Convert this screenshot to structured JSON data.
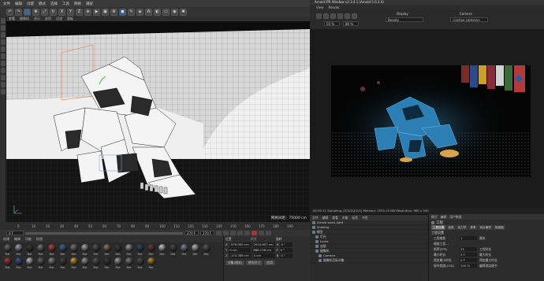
{
  "c4d": {
    "menubar": [
      "文件",
      "编辑",
      "创建",
      "模式",
      "选择",
      "工具",
      "网格",
      "捕捉"
    ],
    "toolbar_x_label": "X",
    "toolbar_y_label": "Y",
    "toolbar_z_label": "Z",
    "viewport_header": [
      "查看",
      "摄像机",
      "显示",
      "选项",
      "过滤",
      "面板"
    ],
    "grid_spacing": "网格间距：75000 cm",
    "timeline_ticks": [
      "0",
      "10",
      "20",
      "30",
      "40",
      "50",
      "60",
      "70",
      "80",
      "90",
      "100",
      "110",
      "120",
      "130",
      "140",
      "150",
      "160",
      "170",
      "180",
      "190"
    ],
    "current_frame": "0 F",
    "end_frame_1": "270 F",
    "end_frame_2": "270 F",
    "material_header": [
      "创建",
      "编辑",
      "功能",
      "纹理"
    ],
    "materials": [
      "Mat",
      "Mat",
      "Mat",
      "Mat",
      "Mat",
      "Mat",
      "Mat",
      "Mat",
      "Mat",
      "Mat",
      "Mat",
      "Mat",
      "Mat",
      "Mat",
      "Mat",
      "Mat",
      "Mat",
      "Mat",
      "Mat",
      "Mat",
      "Mat",
      "Mat",
      "Mat",
      "Mat",
      "Mat",
      "Mat",
      "Mat",
      "Mat",
      "Mat",
      "Mat",
      "Mat",
      "Mat",
      "Mat"
    ],
    "coords": {
      "headers": [
        "位置",
        "尺寸",
        "旋转"
      ],
      "rows": [
        {
          "axis": "X",
          "pos": "-576.983 cm",
          "size": "2024.657 cm",
          "rot_label": "H",
          "rot": "0 °"
        },
        {
          "axis": "Y",
          "pos": "0 cm",
          "size": "868.136 cm",
          "rot_label": "P",
          "rot": "0 °"
        },
        {
          "axis": "Z",
          "pos": "-174.389 cm",
          "size": "0 cm",
          "rot_label": "B",
          "rot": "0 °"
        }
      ],
      "mode_object": "对象(相对)",
      "mode_size": "绝对尺寸",
      "apply_button": "应用"
    }
  },
  "arnold": {
    "title": "Arnold IPR Window v2.3.4.1 (Arnold 5.0.2.4)",
    "menu": [
      "View",
      "Render"
    ],
    "toolbar_display_label": "Display",
    "toolbar_camera_label": "Camera",
    "zoom": "50 %",
    "size_pct": "80 %",
    "display_value": "Beauty",
    "camera_value": "<active camera>",
    "status": "00:00:11  Sampling: [3/2/2/2/2/2]  Memory: 1555.19 MB  Resolution: 960 x 540"
  },
  "object_manager": {
    "header": [
      "文件",
      "编辑",
      "查看",
      "对象",
      "标签",
      "书签"
    ],
    "rows": [
      "Arnold quad_light",
      "Shading",
      "模型",
      "灯光",
      "Luma",
      "连接",
      "摄像机",
      "Camera",
      "摄像机目标对象"
    ]
  },
  "attribute_manager": {
    "header": [
      "模式",
      "编辑",
      "用户数据"
    ],
    "project_label": "工程",
    "tabs": [
      "工程设置",
      "信息",
      "动力学",
      "参考",
      "待办事项",
      "帧插值"
    ],
    "section": "工程设置",
    "rows": [
      {
        "label": "工程缩放",
        "value": "1",
        "extra": "厘米"
      },
      {
        "label": "缩放工程..."
      },
      {
        "label": "帧率(FPS)",
        "value": "25",
        "extra": "工程时长"
      },
      {
        "label": "最小时长",
        "value": "0 F",
        "extra": "最大时长"
      },
      {
        "label": "预览最小时长",
        "value": "0 F",
        "extra": "预览最大时长"
      },
      {
        "label": "细节程度(LOD)",
        "value": "100 %",
        "extra": "编辑渲染细节"
      }
    ]
  }
}
